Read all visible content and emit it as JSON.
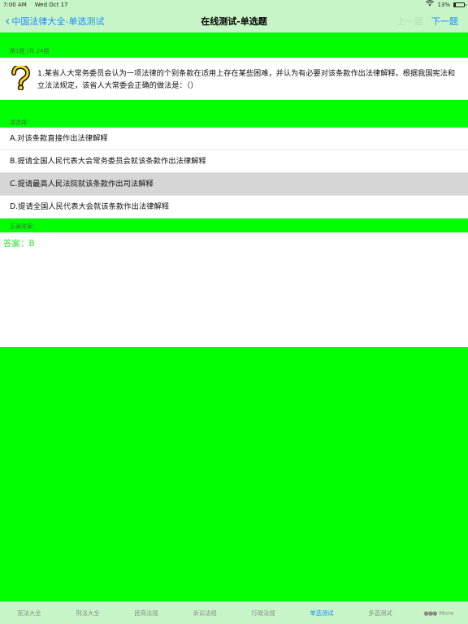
{
  "status_bar": {
    "time": "7:00 AM",
    "date": "Wed Oct 17",
    "battery": "13%",
    "battery_level": 0.13
  },
  "nav": {
    "back_label": "中国法律大全-单选测试",
    "title": "在线测试-单选题",
    "prev_label": "上一题",
    "next_label": "下一题"
  },
  "question_header": "第1题 (共 24题",
  "question": {
    "icon": "question-mark-icon",
    "text": "1.某省人大常务委员会认为一项法律的个别条款在适用上存在某些困难，并认为有必要对该条款作出法律解释。根据我国宪法和立法法规定，该省人大常委会正确的做法是：（）"
  },
  "options_header": "请选择：",
  "options": [
    {
      "label": "A.对该条款直接作出法律解释",
      "selected": false
    },
    {
      "label": "B.提请全国人民代表大会常务委员会就该条款作出法律解释",
      "selected": false
    },
    {
      "label": "C.提请最高人民法院就该条款作出司法解释",
      "selected": true
    },
    {
      "label": "D.提请全国人民代表大会就该条款作出法律解释",
      "selected": false
    }
  ],
  "answer_header": "正确答案：",
  "answer_text": "答案：B",
  "tabs": [
    {
      "label": "宪法大全",
      "active": false
    },
    {
      "label": "刑法大全",
      "active": false
    },
    {
      "label": "民商法规",
      "active": false
    },
    {
      "label": "诉讼法规",
      "active": false
    },
    {
      "label": "行政法规",
      "active": false
    },
    {
      "label": "单选测试",
      "active": true
    },
    {
      "label": "多选测试",
      "active": false
    },
    {
      "label": "More",
      "active": false
    }
  ],
  "colors": {
    "band_green": "#00ff00",
    "bar_green": "#c8f5c8",
    "accent_blue": "#1a8cff",
    "answer_green": "#38e238"
  }
}
